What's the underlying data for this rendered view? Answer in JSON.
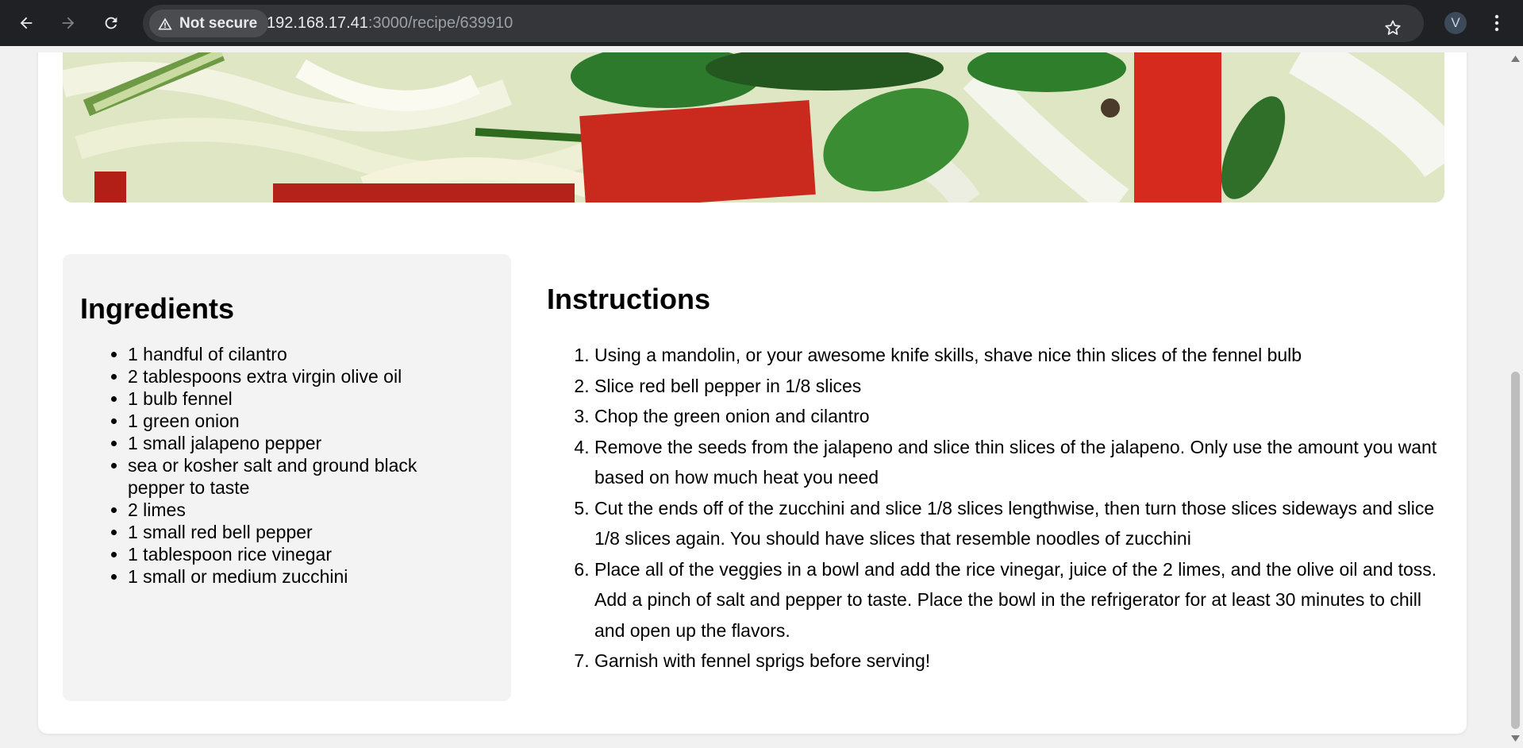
{
  "browser": {
    "security_label": "Not secure",
    "url_host": "192.168.17.41",
    "url_path": ":3000/recipe/639910",
    "profile_initial": "V"
  },
  "recipe": {
    "ingredients_title": "Ingredients",
    "ingredients": [
      "1 handful of cilantro",
      "2 tablespoons extra virgin olive oil",
      "1 bulb fennel",
      "1 green onion",
      "1 small jalapeno pepper",
      "sea or kosher salt and ground black pepper to taste",
      "2 limes",
      "1 small red bell pepper",
      "1 tablespoon rice vinegar",
      "1 small or medium zucchini"
    ],
    "instructions_title": "Instructions",
    "instructions": [
      "Using a mandolin, or your awesome knife skills, shave nice thin slices of the fennel bulb",
      "Slice red bell pepper in 1/8 slices",
      "Chop the green onion and cilantro",
      "Remove the seeds from the jalapeno and slice thin slices of the jalapeno. Only use the amount you want based on how much heat you need",
      "Cut the ends off of the zucchini and slice 1/8 slices lengthwise, then turn those slices sideways and slice 1/8 slices again. You should have slices that resemble noodles of zucchini",
      "Place all of the veggies in a bowl and add the rice vinegar, juice of the 2 limes, and the olive oil and toss. Add a pinch of salt and pepper to taste. Place the bowl in the refrigerator for at least 30 minutes to chill and open up the flavors.",
      "Garnish with fennel sprigs before serving!"
    ]
  },
  "icons": {
    "back": "back-arrow-icon",
    "forward": "forward-arrow-icon",
    "reload": "reload-icon",
    "warning": "warning-triangle-icon",
    "bookmark": "star-icon",
    "menu": "kebab-menu-icon"
  },
  "colors": {
    "chrome_bg": "#202124",
    "omnibox_bg": "#35363a",
    "page_bg": "#f1f1f1",
    "card_bg": "#ffffff",
    "ingredients_bg": "#f3f3f3"
  }
}
